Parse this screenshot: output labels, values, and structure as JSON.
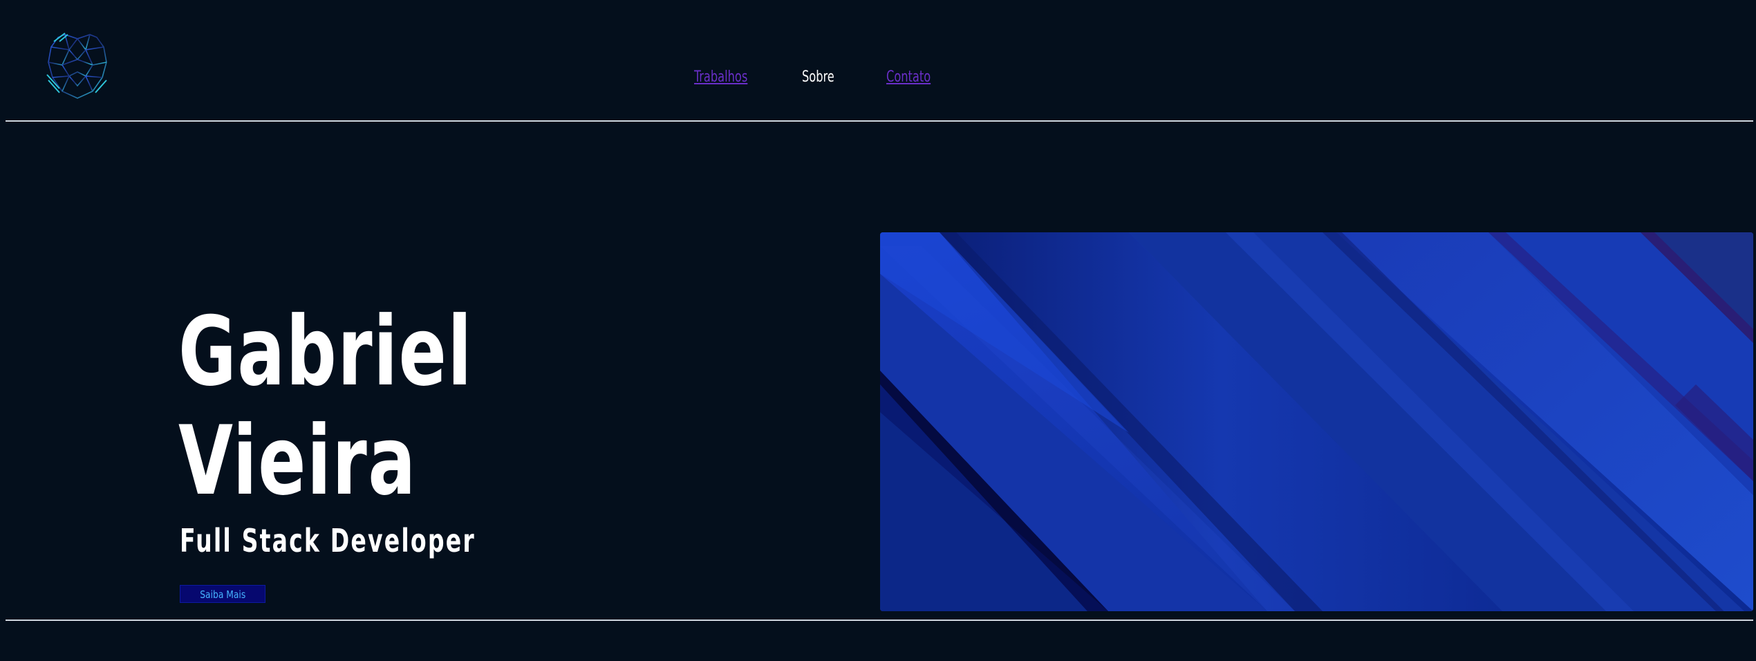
{
  "nav": {
    "items": [
      {
        "label": "Trabalhos",
        "state": "link"
      },
      {
        "label": "Sobre",
        "state": "current"
      },
      {
        "label": "Contato",
        "state": "link"
      }
    ]
  },
  "hero": {
    "name_line1": "Gabriel",
    "name_line2": "Vieira",
    "subtitle": "Full Stack Developer",
    "cta_label": "Saiba Mais"
  },
  "icons": {
    "logo": "tiger-head-logo"
  },
  "colors": {
    "background": "#040f1c",
    "link": "#6a2fc9",
    "cta_background": "#06086f",
    "cta_text": "#45b3ff",
    "hero_image_primary": "#1238b8"
  }
}
